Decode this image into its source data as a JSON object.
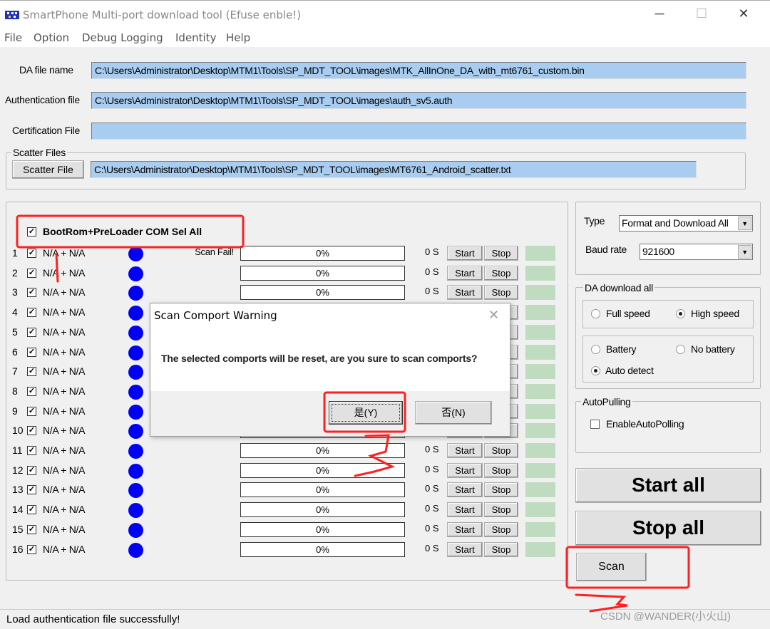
{
  "window": {
    "title": "SmartPhone Multi-port download tool (Efuse enble!)",
    "controls": [
      "minimize-icon",
      "maximize-icon",
      "close-icon"
    ]
  },
  "menu": [
    "File",
    "Option",
    "Debug Logging",
    "Identity",
    "Help"
  ],
  "files": {
    "da_label": "DA file name",
    "da_value": "C:\\Users\\Administrator\\Desktop\\MTM1\\Tools\\SP_MDT_TOOL\\images\\MTK_AllInOne_DA_with_mt6761_custom.bin",
    "auth_label": "Authentication file",
    "auth_value": "C:\\Users\\Administrator\\Desktop\\MTM1\\Tools\\SP_MDT_TOOL\\images\\auth_sv5.auth",
    "cert_label": "Certification File",
    "cert_value": "",
    "scatter_group": "Scatter Files",
    "scatter_button": "Scatter File",
    "scatter_value": "C:\\Users\\Administrator\\Desktop\\MTM1\\Tools\\SP_MDT_TOOL\\images\\MT6761_Android_scatter.txt"
  },
  "ports": {
    "sel_all_label": "BootRom+PreLoader COM Sel All",
    "sel_all_checked": true,
    "start_label": "Start",
    "stop_label": "Stop",
    "status_color": "#0000f5",
    "indicator_color": "#c0dcc0",
    "rows": [
      {
        "num": "1",
        "name": "N/A + N/A",
        "status": "Scan Fail!",
        "progress": "0%",
        "time": "0 S"
      },
      {
        "num": "2",
        "name": "N/A + N/A",
        "status": "",
        "progress": "0%",
        "time": "0 S"
      },
      {
        "num": "3",
        "name": "N/A + N/A",
        "status": "",
        "progress": "0%",
        "time": "0 S"
      },
      {
        "num": "4",
        "name": "N/A + N/A",
        "status": "",
        "progress": "0%",
        "time": "0 S"
      },
      {
        "num": "5",
        "name": "N/A + N/A",
        "status": "",
        "progress": "0%",
        "time": "0 S"
      },
      {
        "num": "6",
        "name": "N/A + N/A",
        "status": "",
        "progress": "0%",
        "time": "0 S"
      },
      {
        "num": "7",
        "name": "N/A + N/A",
        "status": "",
        "progress": "0%",
        "time": "0 S"
      },
      {
        "num": "8",
        "name": "N/A + N/A",
        "status": "",
        "progress": "0%",
        "time": "0 S"
      },
      {
        "num": "9",
        "name": "N/A + N/A",
        "status": "",
        "progress": "0%",
        "time": "0 S"
      },
      {
        "num": "10",
        "name": "N/A + N/A",
        "status": "",
        "progress": "0%",
        "time": "0 S"
      },
      {
        "num": "11",
        "name": "N/A + N/A",
        "status": "",
        "progress": "0%",
        "time": "0 S"
      },
      {
        "num": "12",
        "name": "N/A + N/A",
        "status": "",
        "progress": "0%",
        "time": "0 S"
      },
      {
        "num": "13",
        "name": "N/A + N/A",
        "status": "",
        "progress": "0%",
        "time": "0 S"
      },
      {
        "num": "14",
        "name": "N/A + N/A",
        "status": "",
        "progress": "0%",
        "time": "0 S"
      },
      {
        "num": "15",
        "name": "N/A + N/A",
        "status": "",
        "progress": "0%",
        "time": "0 S"
      },
      {
        "num": "16",
        "name": "N/A + N/A",
        "status": "",
        "progress": "0%",
        "time": "0 S"
      }
    ]
  },
  "settings": {
    "type_label": "Type",
    "type_value": "Format and Download All",
    "baud_label": "Baud rate",
    "baud_value": "921600"
  },
  "da_download": {
    "group": "DA download all",
    "full_speed": "Full speed",
    "high_speed": "High speed",
    "battery": "Battery",
    "no_battery": "No battery",
    "auto_detect": "Auto detect",
    "speed_selected": "High speed",
    "battery_selected": "Auto detect"
  },
  "autopolling": {
    "group": "AutoPulling",
    "checkbox": "EnableAutoPolling",
    "checked": false
  },
  "actions": {
    "start_all": "Start all",
    "stop_all": "Stop all",
    "scan": "Scan"
  },
  "status_bar": "Load authentication file successfully!",
  "dialog": {
    "title": "Scan Comport Warning",
    "message": "The selected comports will be reset, are you sure to scan comports?",
    "yes": "是(Y)",
    "no": "否(N)"
  },
  "watermark": "CSDN @WANDER(小火山)",
  "annotation_color": "#ff2020"
}
